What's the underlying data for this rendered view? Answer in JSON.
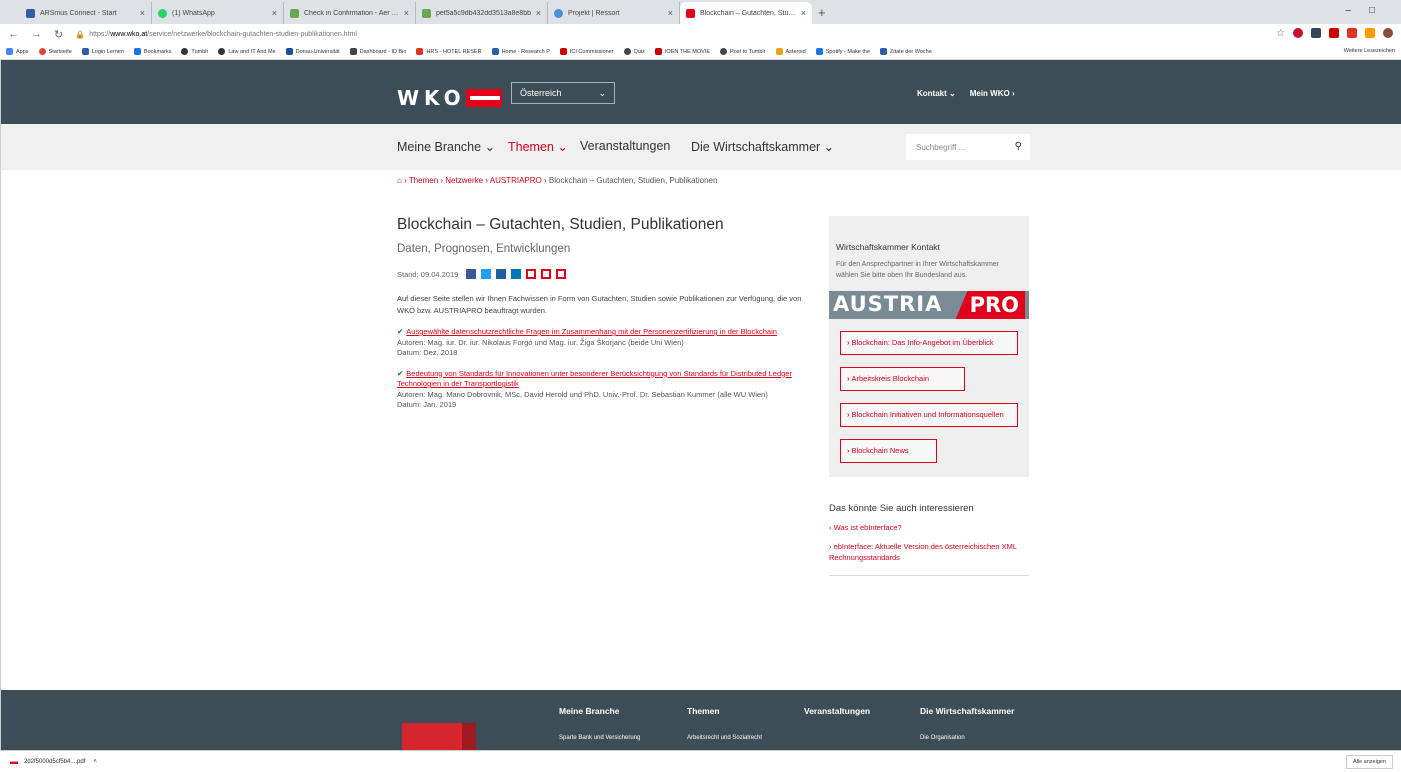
{
  "browser": {
    "tabs": [
      {
        "title": "ARSmus Connect - Start",
        "color": "#2d5fa8"
      },
      {
        "title": "(1) WhatsApp",
        "color": "#25d366"
      },
      {
        "title": "Check in Confirmation - Aer Lin",
        "color": "#6aa84f"
      },
      {
        "title": "pet5a5c9db432dd3513a8e8bb",
        "color": "#6aa84f"
      },
      {
        "title": "Projekt | Ressort",
        "color": "#4a90d9"
      },
      {
        "title": "Blockchain – Gutachten, Studien",
        "color": "#e2001a"
      }
    ],
    "newtab": "+",
    "url_scheme": "https://",
    "url_host": "www.wko.at",
    "url_path": "/service/netzwerke/blockchain-gutachten-studien-publikationen.html",
    "bookmarks": [
      "Apps",
      "Startseite",
      "Login Lernen",
      "Bookmarks",
      "Tumblr",
      "Law and IT And Me",
      "Donau-Universität",
      "Dashboard - ID Bio",
      "HRS - HOTEL RESER",
      "Home - Research P",
      "ICI Commissioner",
      "Quiz",
      "IOEN THE MOVIE",
      "Post to Tumblr",
      "Asteroid",
      "Spotify - Make the",
      "Zitate der Woche"
    ],
    "bookmarks_more": "Weitere Lesezeichen"
  },
  "header": {
    "logo": "WKO",
    "country": "Österreich",
    "kontakt": "Kontakt",
    "meinwko": "Mein WKO"
  },
  "nav": {
    "items": [
      "Meine Branche",
      "Themen",
      "Veranstaltungen",
      "Die Wirtschaftskammer"
    ],
    "search_placeholder": "Suchbegriff ..."
  },
  "breadcrumb": {
    "items": [
      "Themen",
      "Netzwerke",
      "AUSTRIAPRO"
    ],
    "current": "Blockchain – Gutachten, Studien, Publikationen"
  },
  "article": {
    "title": "Blockchain – Gutachten, Studien, Publikationen",
    "subtitle": "Daten, Prognosen, Entwicklungen",
    "stand": "Stand: 09.04.2019",
    "intro": "Auf dieser Seite stellen wir Ihnen Fachwissen in Form von Gutachten, Studien sowie Publikationen zur Verfügung, die von WKÖ bzw. AUSTRIAPRO beauftragt wurden.",
    "items": [
      {
        "link": "Ausgewählte datenschutzrechtliche Fragen im Zusammenhang mit der Personenzertifizierung in der Blockchain",
        "authors": "Autoren: Mag. iur. Dr. iur. Nikolaus Forgó und Mag. iur. Žiga Škorjanc (beide Uni Wien)",
        "date": "Datum: Dez. 2018"
      },
      {
        "link": "Bedeutung von Standards für Innovationen unter besonderer Berücksichtigung von Standards für Distributed Ledger Technologien in der Transportlogistik",
        "authors": "Autoren: Mag. Mario Dobrovnik, MSc, David Herold und PhD. Univ.-Prof. Dr. Sebastian Kummer (alle WU Wien)",
        "date": "Datum: Jan. 2019"
      }
    ]
  },
  "sidebar": {
    "kontakt_title": "Wirtschaftskammer Kontakt",
    "kontakt_text": "Für den Ansprechpartner in Ihrer Wirtschaftskammer wählen Sie bitte oben Ihr Bundesland aus.",
    "banner_left": "AUSTRIA",
    "banner_right": "PRO",
    "links": [
      "Blockchain: Das Info-Angebot im Überblick",
      "Arbeitskreis Blockchain",
      "Blockchain Initiativen und Informationsquellen",
      "Blockchain News"
    ],
    "interest_title": "Das könnte Sie auch interessieren",
    "interest_links": [
      "Was ist ebInterface?",
      "ebInterface: Aktuelle Version des österreichischen XML Rechnungsstandards"
    ]
  },
  "footer": {
    "cols": [
      "Meine Branche",
      "Themen",
      "Veranstaltungen",
      "Die Wirtschaftskammer"
    ],
    "subs": [
      "Sparte Bank und Versicherung",
      "Arbeitsrecht und Sozialrecht",
      "Die Organisation"
    ]
  },
  "download": {
    "file": "2d2f5000d5cf5b4....pdf",
    "show_all": "Alle anzeigen"
  }
}
